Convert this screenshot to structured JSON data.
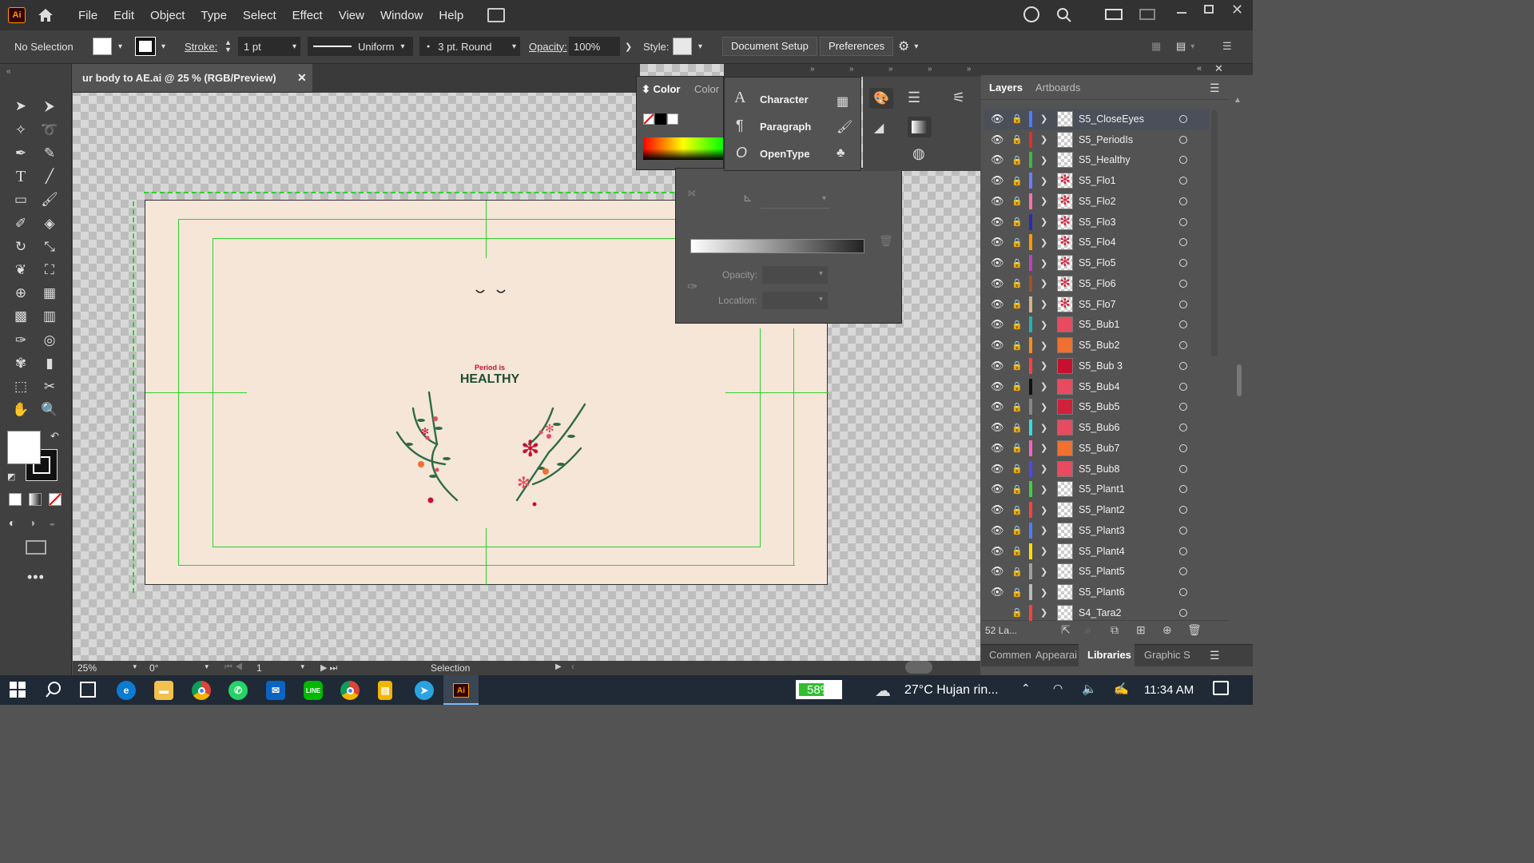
{
  "menubar": {
    "logo": "Ai",
    "items": [
      "File",
      "Edit",
      "Object",
      "Type",
      "Select",
      "Effect",
      "View",
      "Window",
      "Help"
    ]
  },
  "control": {
    "selection": "No Selection",
    "stroke_label": "Stroke:",
    "stroke_value": "1 pt",
    "profile": "Uniform",
    "brush": "3 pt. Round",
    "opacity_label": "Opacity:",
    "opacity_value": "100%",
    "style_label": "Style:",
    "doc_setup": "Document Setup",
    "preferences": "Preferences"
  },
  "document": {
    "tab_title": "ur body to AE.ai @ 25 % (RGB/Preview)",
    "art_line1": "Period is",
    "art_line2": "HEALTHY"
  },
  "color_panel": {
    "tab1": "Color",
    "tab2": "Color",
    "opacity_label": "Opacity:",
    "location_label": "Location:"
  },
  "type_panel": {
    "items": [
      "Character",
      "Paragraph",
      "OpenType"
    ]
  },
  "layers_panel": {
    "tab_layers": "Layers",
    "tab_artboards": "Artboards",
    "count": "52 La...",
    "layers": [
      {
        "name": "S5_CloseEyes",
        "color": "#4f7cff",
        "thumb": "checker"
      },
      {
        "name": "S5_PeriodIs",
        "color": "#e03030",
        "thumb": "checker"
      },
      {
        "name": "S5_Healthy",
        "color": "#3db83d",
        "thumb": "checker"
      },
      {
        "name": "S5_Flo1",
        "color": "#6b7cff",
        "thumb": "flower"
      },
      {
        "name": "S5_Flo2",
        "color": "#ff6fb0",
        "thumb": "flower"
      },
      {
        "name": "S5_Flo3",
        "color": "#2a2ab8",
        "thumb": "flower"
      },
      {
        "name": "S5_Flo4",
        "color": "#ff9a00",
        "thumb": "flower"
      },
      {
        "name": "S5_Flo5",
        "color": "#c040c0",
        "thumb": "flower"
      },
      {
        "name": "S5_Flo6",
        "color": "#a0522d",
        "thumb": "flower"
      },
      {
        "name": "S5_Flo7",
        "color": "#d2b48c",
        "thumb": "flower"
      },
      {
        "name": "S5_Bub1",
        "color": "#1fb5b5",
        "thumb": "#e84a5f"
      },
      {
        "name": "S5_Bub2",
        "color": "#ff8c1a",
        "thumb": "#f07030"
      },
      {
        "name": "S5_Bub 3",
        "color": "#ff4040",
        "thumb": "#c8102e"
      },
      {
        "name": "S5_Bub4",
        "color": "#111111",
        "thumb": "#e84a5f"
      },
      {
        "name": "S5_Bub5",
        "color": "#888888",
        "thumb": "#d0203a"
      },
      {
        "name": "S5_Bub6",
        "color": "#30e0e0",
        "thumb": "#e84a5f"
      },
      {
        "name": "S5_Bub7",
        "color": "#ff60c0",
        "thumb": "#f07030"
      },
      {
        "name": "S5_Bub8",
        "color": "#4848ff",
        "thumb": "#e84a5f"
      },
      {
        "name": "S5_Plant1",
        "color": "#3dd13d",
        "thumb": "checker"
      },
      {
        "name": "S5_Plant2",
        "color": "#ff4040",
        "thumb": "checker"
      },
      {
        "name": "S5_Plant3",
        "color": "#4f7cff",
        "thumb": "checker"
      },
      {
        "name": "S5_Plant4",
        "color": "#ffe000",
        "thumb": "checker"
      },
      {
        "name": "S5_Plant5",
        "color": "#a0a0a0",
        "thumb": "checker"
      },
      {
        "name": "S5_Plant6",
        "color": "#bbbbbb",
        "thumb": "checker"
      },
      {
        "name": "S4_Tara2",
        "color": "#ff4040",
        "thumb": "checker"
      }
    ]
  },
  "bottom_tabs": [
    "Commen",
    "Appearai",
    "Libraries",
    "Graphic S"
  ],
  "status": {
    "zoom": "25%",
    "rotation": "0°",
    "artboard": "1",
    "tool": "Selection"
  },
  "taskbar": {
    "battery": "58%",
    "weather": "27°C  Hujan rin...",
    "time": "11:34 AM"
  }
}
